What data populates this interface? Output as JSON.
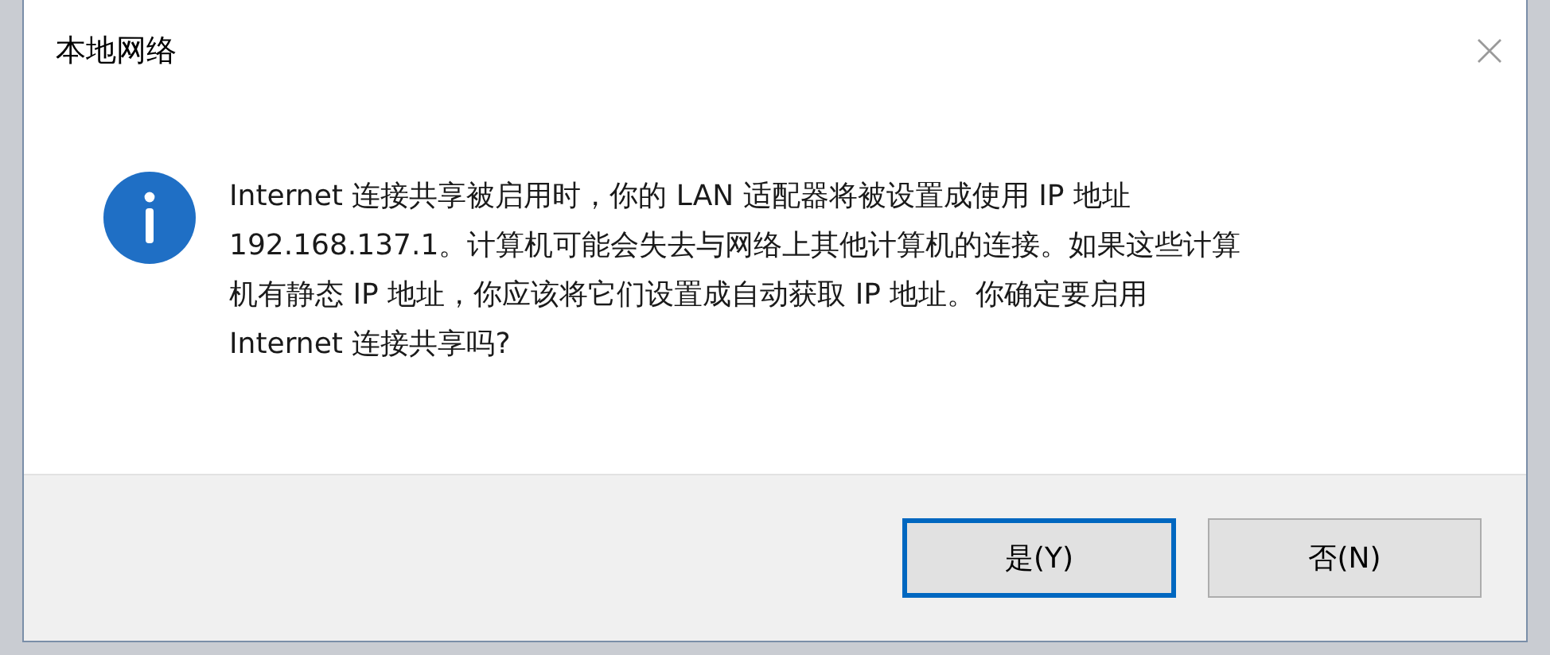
{
  "window": {
    "title": "本地网络"
  },
  "message": {
    "lines": [
      "Internet 连接共享被启用时，你的 LAN 适配器将被设置成使用 IP 地址",
      "192.168.137.1。计算机可能会失去与网络上其他计算机的连接。如果这些计算",
      "机有静态 IP 地址，你应该将它们设置成自动获取 IP 地址。你确定要启用",
      "Internet 连接共享吗?"
    ]
  },
  "buttons": [
    {
      "label": "是(Y)",
      "default": true
    },
    {
      "label": "否(N)",
      "default": false
    }
  ]
}
